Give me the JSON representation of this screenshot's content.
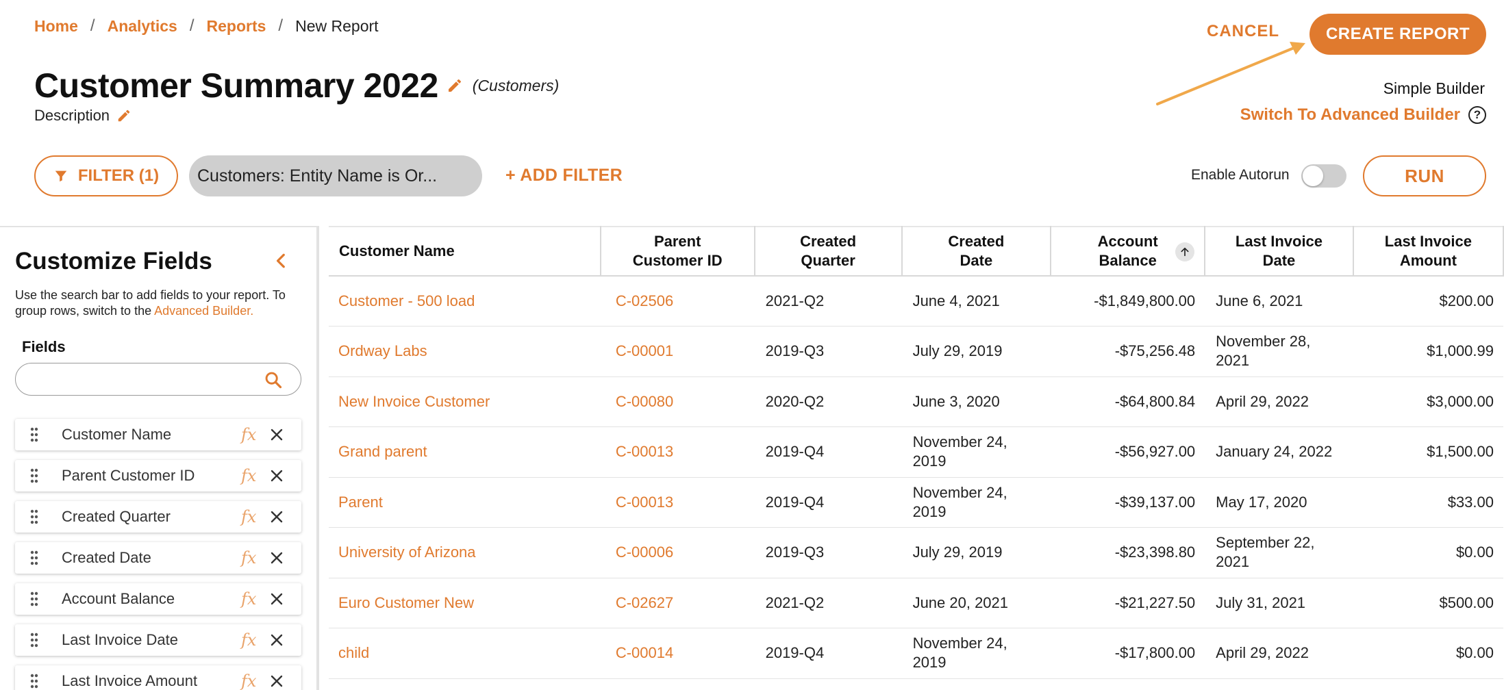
{
  "breadcrumb": {
    "items": [
      "Home",
      "Analytics",
      "Reports"
    ],
    "separator": "/",
    "current": "New Report"
  },
  "header": {
    "title": "Customer Summary 2022",
    "entity": "(Customers)",
    "description_label": "Description"
  },
  "actions": {
    "cancel_label": "CANCEL",
    "create_label": "CREATE REPORT",
    "builder_mode": "Simple Builder",
    "switch_label": "Switch To Advanced Builder",
    "help_glyph": "?"
  },
  "filters": {
    "filter_button_label": "FILTER (1)",
    "active_filter": "Customers: Entity Name is Or...",
    "add_filter_label": "+ ADD FILTER",
    "autorun_label": "Enable Autorun",
    "autorun_enabled": false,
    "run_label": "RUN"
  },
  "customize": {
    "title": "Customize Fields",
    "help_text": "Use the search bar to add fields to your report. To group rows, switch to the",
    "help_link": "Advanced Builder.",
    "fields_label": "Fields",
    "search_placeholder": "",
    "fx_label": "fx",
    "fields": [
      "Customer Name",
      "Parent Customer ID",
      "Created Quarter",
      "Created Date",
      "Account Balance",
      "Last Invoice Date",
      "Last Invoice Amount"
    ]
  },
  "table": {
    "columns": [
      "Customer Name",
      "Parent Customer ID",
      "Created Quarter",
      "Created Date",
      "Account Balance",
      "Last Invoice Date",
      "Last Invoice Amount"
    ],
    "sorted_column": "Account Balance",
    "sort_direction": "ascending",
    "rows": [
      [
        "Customer - 500 load",
        "C-02506",
        "2021-Q2",
        "June 4, 2021",
        "-$1,849,800.00",
        "June 6, 2021",
        "$200.00"
      ],
      [
        "Ordway Labs",
        "C-00001",
        "2019-Q3",
        "July 29, 2019",
        "-$75,256.48",
        "November 28, 2021",
        "$1,000.99"
      ],
      [
        "New Invoice Customer",
        "C-00080",
        "2020-Q2",
        "June 3, 2020",
        "-$64,800.84",
        "April 29, 2022",
        "$3,000.00"
      ],
      [
        "Grand parent",
        "C-00013",
        "2019-Q4",
        "November 24, 2019",
        "-$56,927.00",
        "January 24, 2022",
        "$1,500.00"
      ],
      [
        "Parent",
        "C-00013",
        "2019-Q4",
        "November 24, 2019",
        "-$39,137.00",
        "May 17, 2020",
        "$33.00"
      ],
      [
        "University of Arizona",
        "C-00006",
        "2019-Q3",
        "July 29, 2019",
        "-$23,398.80",
        "September 22, 2021",
        "$0.00"
      ],
      [
        "Euro Customer New",
        "C-02627",
        "2021-Q2",
        "June 20, 2021",
        "-$21,227.50",
        "July 31, 2021",
        "$500.00"
      ],
      [
        "child",
        "C-00014",
        "2019-Q4",
        "November 24, 2019",
        "-$17,800.00",
        "April 29, 2022",
        "$0.00"
      ]
    ]
  },
  "colors": {
    "accent": "#e07a2e",
    "chip_bg": "#cfcfcf"
  }
}
